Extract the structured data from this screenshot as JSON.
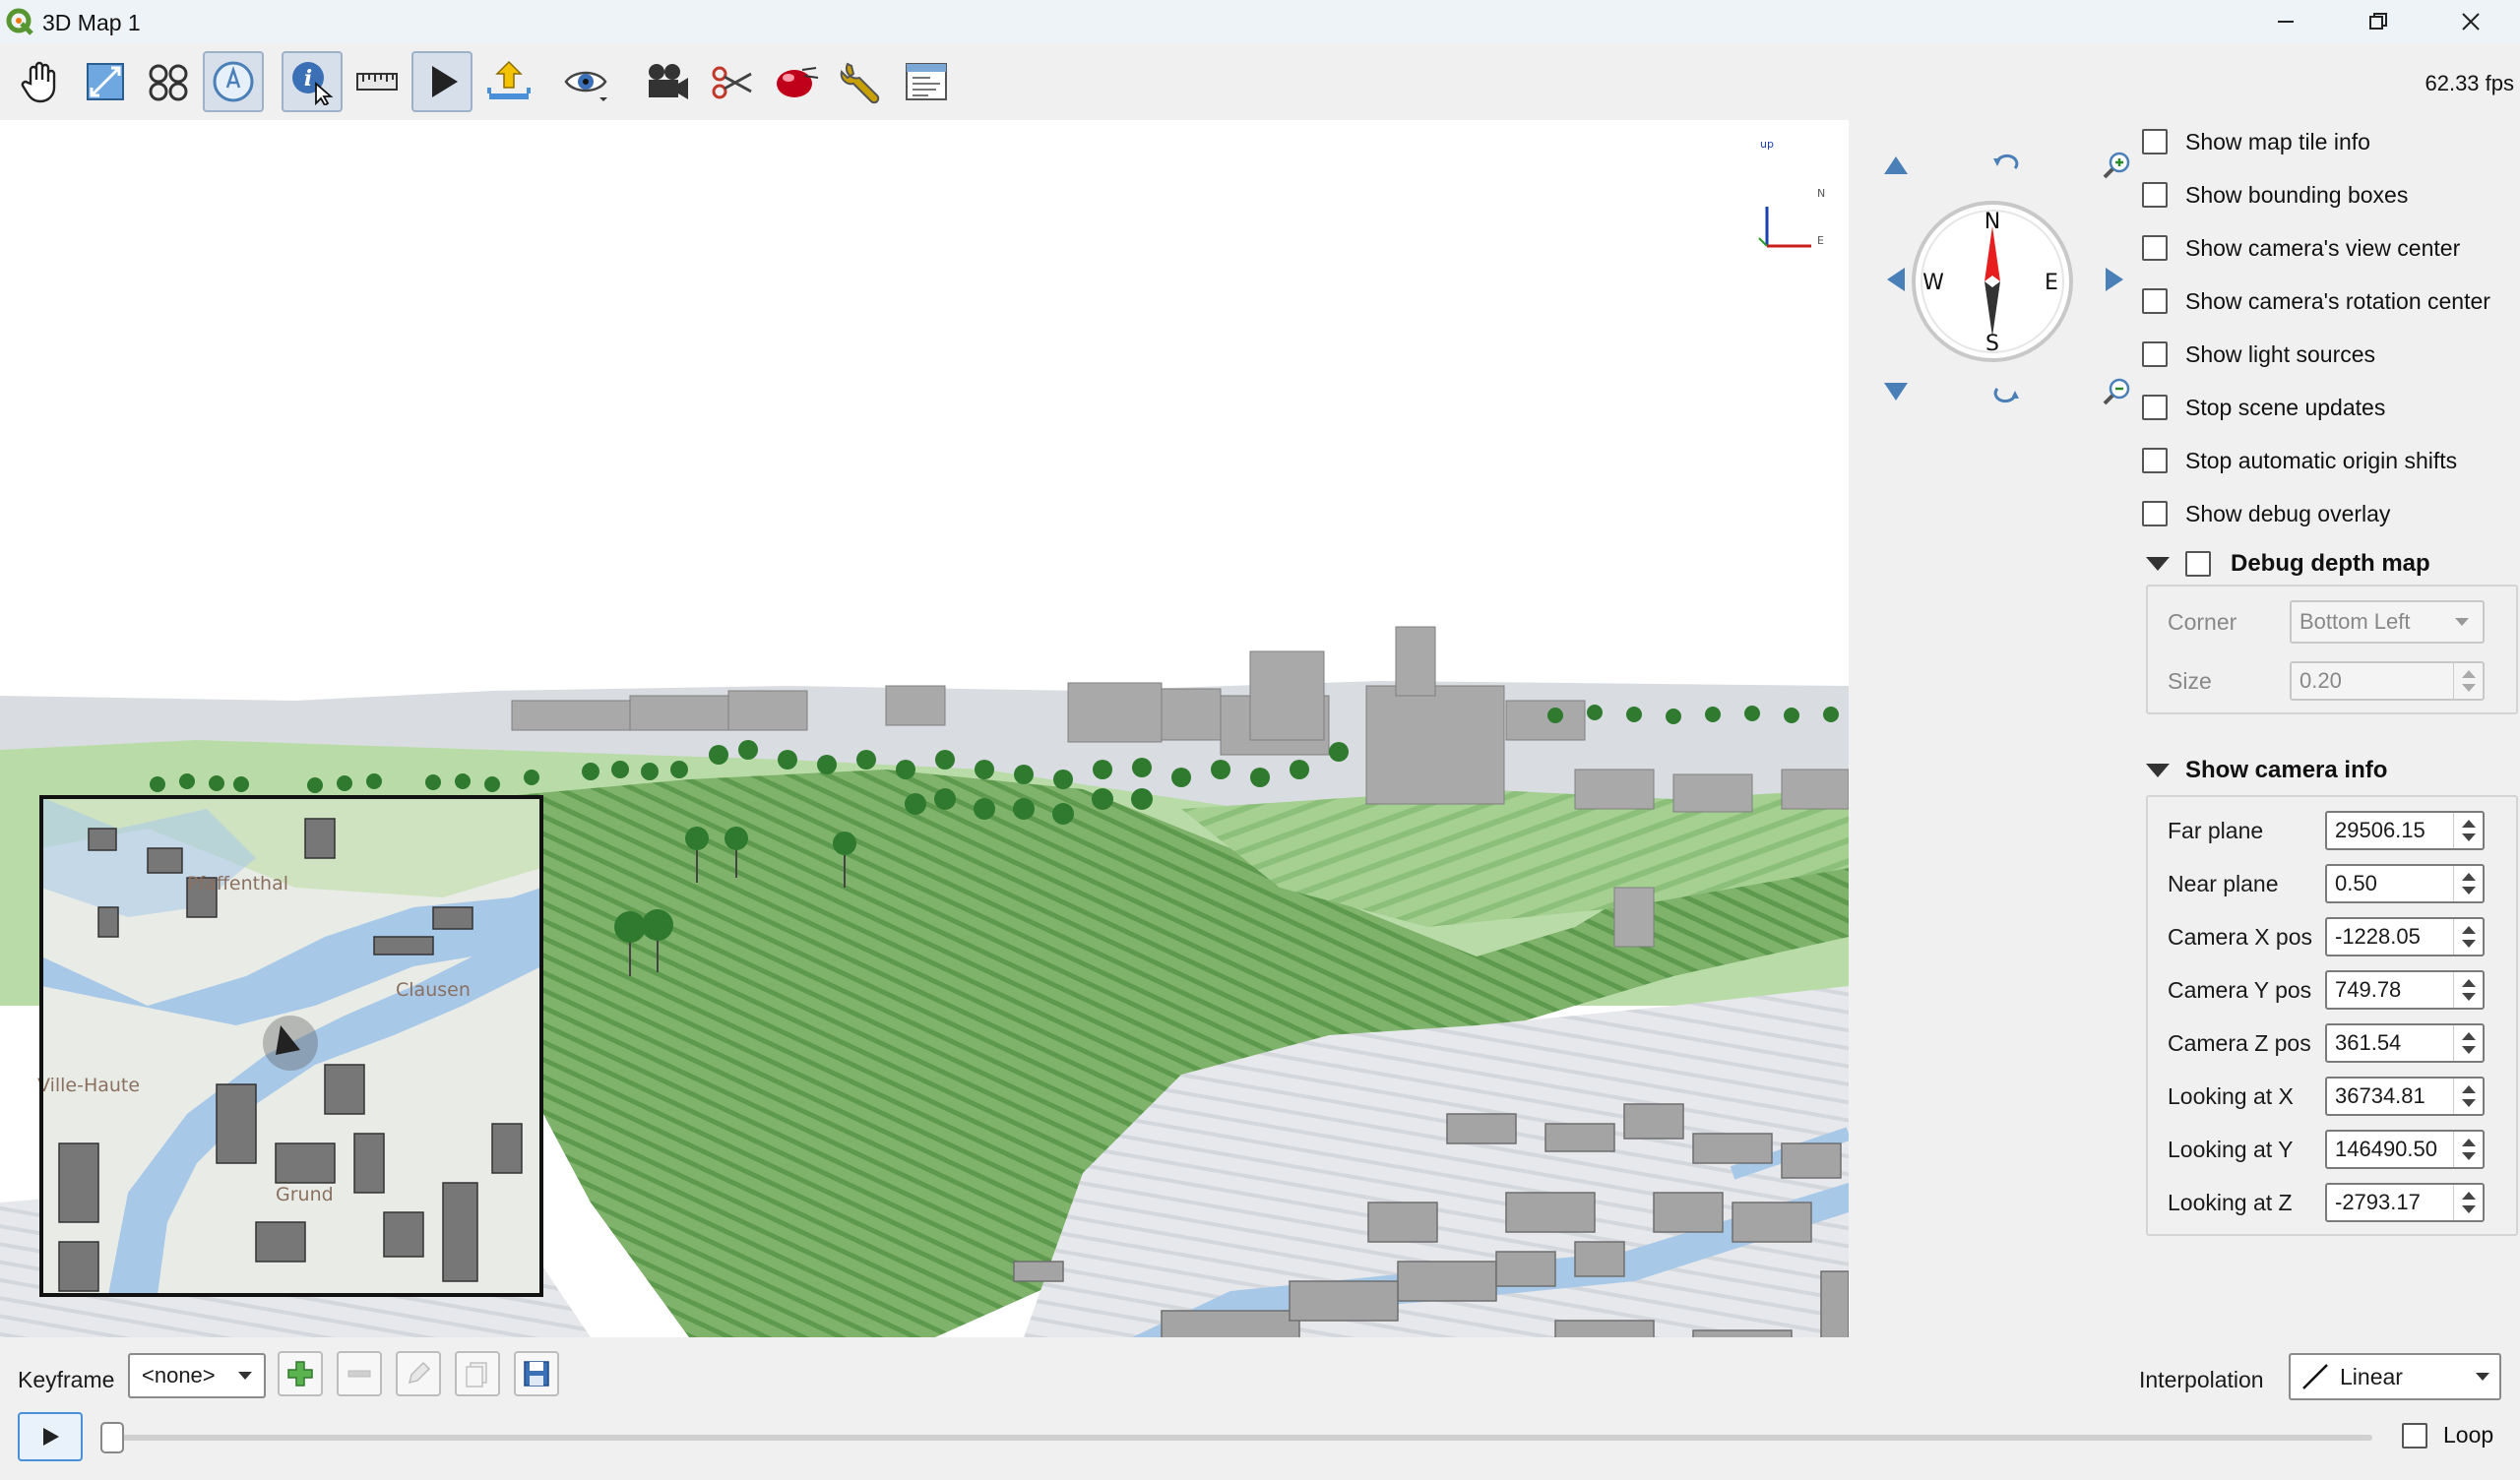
{
  "window": {
    "title": "3D Map 1"
  },
  "toolbar": {
    "fps": "62.33 fps",
    "tools": [
      {
        "id": "pan",
        "icon": "pan-hand-icon",
        "active": false
      },
      {
        "id": "zoom-full",
        "icon": "zoom-full-extent-icon",
        "active": false
      },
      {
        "id": "toggle-camera",
        "icon": "camera-toggle-icon",
        "active": false
      },
      {
        "id": "navigation",
        "icon": "compass-icon",
        "active": true
      },
      {
        "id": "identify",
        "icon": "identify-icon",
        "active": true
      },
      {
        "id": "measure",
        "icon": "measure-ruler-icon",
        "active": false
      },
      {
        "id": "animation",
        "icon": "play-animation-icon",
        "active": true
      },
      {
        "id": "export",
        "icon": "export-icon",
        "active": false
      },
      {
        "id": "view",
        "icon": "eye-icon",
        "active": false
      },
      {
        "id": "camera",
        "icon": "camera-icon",
        "active": false
      },
      {
        "id": "clipping",
        "icon": "scissors-icon",
        "active": false
      },
      {
        "id": "effects",
        "icon": "effects-sphere-icon",
        "active": false
      },
      {
        "id": "settings",
        "icon": "wrench-icon",
        "active": false
      },
      {
        "id": "layout",
        "icon": "layout-icon",
        "active": false
      }
    ]
  },
  "viewport": {
    "axis_labels": {
      "up": "up",
      "north": "N",
      "east": "E"
    },
    "minimap_labels": [
      "Pfaffenthal",
      "Clausen",
      "Ville-Haute",
      "Grund"
    ]
  },
  "navigation": {
    "compass": {
      "n": "N",
      "s": "S",
      "e": "E",
      "w": "W"
    }
  },
  "debug_panel": {
    "checkboxes": [
      {
        "label": "Show map tile info",
        "checked": false
      },
      {
        "label": "Show bounding boxes",
        "checked": false
      },
      {
        "label": "Show camera's view center",
        "checked": false
      },
      {
        "label": "Show camera's rotation center",
        "checked": false
      },
      {
        "label": "Show light sources",
        "checked": false
      },
      {
        "label": "Stop scene updates",
        "checked": false
      },
      {
        "label": "Stop automatic origin shifts",
        "checked": false
      },
      {
        "label": "Show debug overlay",
        "checked": false
      }
    ],
    "depth_map": {
      "title": "Debug depth map",
      "checked": false,
      "corner_label": "Corner",
      "corner_value": "Bottom Left",
      "size_label": "Size",
      "size_value": "0.20"
    },
    "camera_info": {
      "title": "Show camera info",
      "fields": [
        {
          "label": "Far plane",
          "value": "29506.15"
        },
        {
          "label": "Near plane",
          "value": "0.50"
        },
        {
          "label": "Camera X pos",
          "value": "-1228.05"
        },
        {
          "label": "Camera Y pos",
          "value": "749.78"
        },
        {
          "label": "Camera Z pos",
          "value": "361.54"
        },
        {
          "label": "Looking at X",
          "value": "36734.81"
        },
        {
          "label": "Looking at Y",
          "value": "146490.50"
        },
        {
          "label": "Looking at Z",
          "value": "-2793.17"
        }
      ]
    }
  },
  "animation": {
    "keyframe_label": "Keyframe",
    "keyframe_value": "<none>",
    "interpolation_label": "Interpolation",
    "interpolation_value": "Linear",
    "loop_label": "Loop",
    "loop_checked": false,
    "progress": 0
  },
  "colors": {
    "terrain_green": "#8cc07a",
    "buildings": "#a9a9a9",
    "river": "#a8c8e8",
    "accent": "#4a90d9"
  }
}
